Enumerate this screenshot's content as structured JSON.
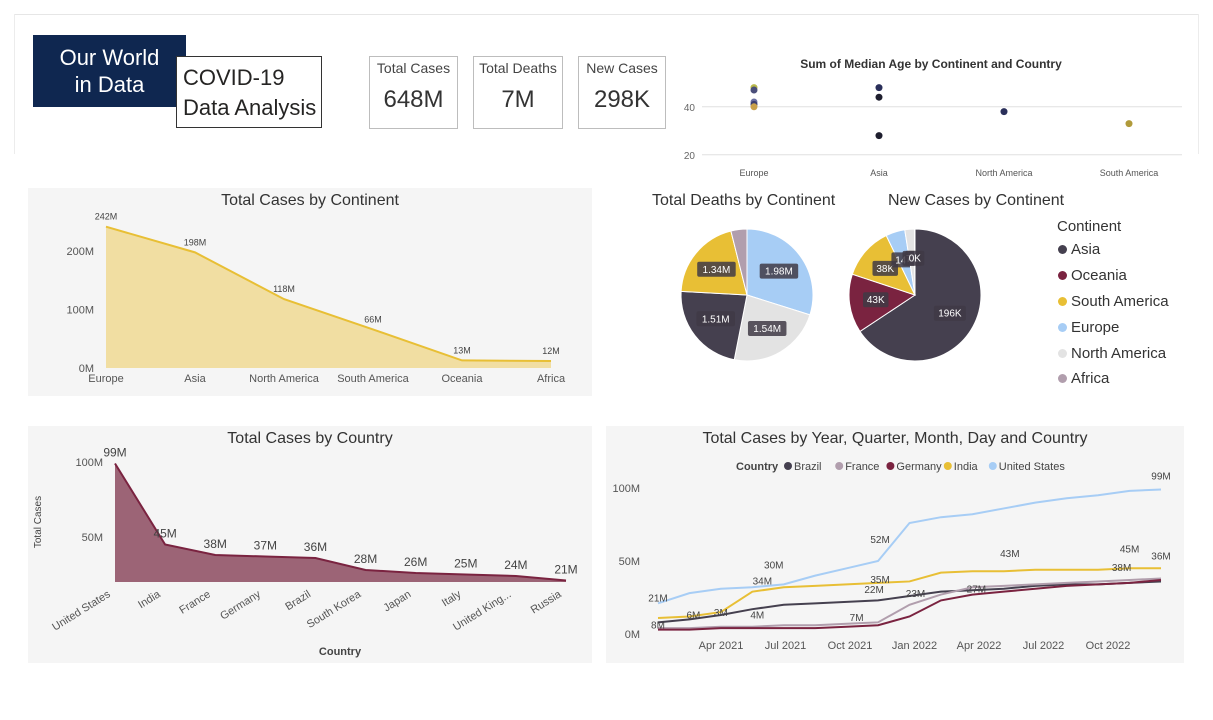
{
  "logo": {
    "line1": "Our World",
    "line2": "in Data"
  },
  "title": {
    "line1": "COVID-19",
    "line2": "Data Analysis"
  },
  "kpis": [
    {
      "label": "Total Cases",
      "value": "648M"
    },
    {
      "label": "Total Deaths",
      "value": "7M"
    },
    {
      "label": "New Cases",
      "value": "298K"
    }
  ],
  "colors": {
    "Asia": "#45404f",
    "Oceania": "#7a2340",
    "South America": "#e8bf35",
    "Europe": "#a7cdf5",
    "North America": "#e3e3e3",
    "Africa": "#b19ead",
    "area_yellow": "#eecf6a",
    "area_maroon": "#8c4a5f"
  },
  "chart_data": [
    {
      "type": "scatter",
      "title": "Sum of Median Age by Continent and Country",
      "categories": [
        "Europe",
        "Asia",
        "North America",
        "South America"
      ],
      "yticks": [
        20,
        40
      ],
      "ylim": [
        17,
        52
      ],
      "points": [
        {
          "category": "Europe",
          "y": 48,
          "color": "#b9b94a"
        },
        {
          "category": "Europe",
          "y": 47,
          "color": "#4a4e7a"
        },
        {
          "category": "Europe",
          "y": 42,
          "color": "#6a6fa0"
        },
        {
          "category": "Europe",
          "y": 41,
          "color": "#3c3e70"
        },
        {
          "category": "Europe",
          "y": 40,
          "color": "#c9a04a"
        },
        {
          "category": "Asia",
          "y": 48,
          "color": "#2a2f5a"
        },
        {
          "category": "Asia",
          "y": 44,
          "color": "#1e1e2e"
        },
        {
          "category": "Asia",
          "y": 28,
          "color": "#1e1e2e"
        },
        {
          "category": "North America",
          "y": 38,
          "color": "#2a2f5a"
        },
        {
          "category": "South America",
          "y": 33,
          "color": "#b09a3a"
        }
      ]
    },
    {
      "type": "area",
      "title": "Total Cases by Continent",
      "categories": [
        "Europe",
        "Asia",
        "North America",
        "South America",
        "Oceania",
        "Africa"
      ],
      "values": [
        242,
        198,
        118,
        66,
        13,
        12
      ],
      "data_labels": [
        "242M",
        "198M",
        "118M",
        "66M",
        "13M",
        "12M"
      ],
      "yticks": [
        "0M",
        "100M",
        "200M"
      ],
      "ylim": [
        0,
        250
      ]
    },
    {
      "type": "pie",
      "title": "Total Deaths by Continent",
      "slices": [
        {
          "name": "Europe",
          "value": 1.98,
          "label": "1.98M"
        },
        {
          "name": "North America",
          "value": 1.54,
          "label": "1.54M"
        },
        {
          "name": "Asia",
          "value": 1.51,
          "label": "1.51M"
        },
        {
          "name": "South America",
          "value": 1.34,
          "label": "1.34M"
        },
        {
          "name": "Africa",
          "value": 0.26,
          "label": ""
        }
      ]
    },
    {
      "type": "pie",
      "title": "New Cases by Continent",
      "slices": [
        {
          "name": "Asia",
          "value": 196,
          "label": "196K"
        },
        {
          "name": "Oceania",
          "value": 43,
          "label": "43K"
        },
        {
          "name": "South America",
          "value": 38,
          "label": "38K"
        },
        {
          "name": "Europe",
          "value": 14,
          "label": "14K"
        },
        {
          "name": "North America",
          "value": 7,
          "label": "7K"
        },
        {
          "name": "Africa",
          "value": 0.4,
          "label": "0K"
        }
      ]
    },
    {
      "type": "area",
      "title": "Total Cases by Country",
      "categories": [
        "United States",
        "India",
        "France",
        "Germany",
        "Brazil",
        "South Korea",
        "Japan",
        "Italy",
        "United King...",
        "Russia"
      ],
      "values": [
        99,
        45,
        38,
        37,
        36,
        28,
        26,
        25,
        24,
        21
      ],
      "data_labels": [
        "99M",
        "45M",
        "38M",
        "37M",
        "36M",
        "28M",
        "26M",
        "25M",
        "24M",
        "21M"
      ],
      "xlabel": "Country",
      "ylabel": "Total Cases",
      "yticks": [
        "50M",
        "100M"
      ],
      "ylim": [
        20,
        100
      ]
    },
    {
      "type": "line",
      "title": "Total Cases by Year, Quarter, Month, Day and Country",
      "legend_title": "Country",
      "xticks": [
        "Apr 2021",
        "Jul 2021",
        "Oct 2021",
        "Jan 2022",
        "Apr 2022",
        "Jul 2022",
        "Oct 2022"
      ],
      "yticks": [
        "0M",
        "50M",
        "100M"
      ],
      "ylim": [
        0,
        100
      ],
      "series": [
        {
          "name": "Brazil",
          "color": "#45404f",
          "points": [
            [
              0,
              8
            ],
            [
              1,
              10
            ],
            [
              2,
              13
            ],
            [
              3,
              17
            ],
            [
              4,
              20
            ],
            [
              5,
              21
            ],
            [
              6,
              22
            ],
            [
              7,
              23
            ],
            [
              8,
              26
            ],
            [
              9,
              29
            ],
            [
              10,
              30
            ],
            [
              11,
              31
            ],
            [
              12,
              33
            ],
            [
              13,
              34
            ],
            [
              14,
              34
            ],
            [
              15,
              35
            ],
            [
              16,
              36
            ]
          ],
          "labels": [
            [
              2,
              "3M"
            ],
            [
              8,
              "23M"
            ]
          ]
        },
        {
          "name": "France",
          "color": "#b19ead",
          "points": [
            [
              0,
              4
            ],
            [
              1,
              4
            ],
            [
              2,
              5
            ],
            [
              3,
              5
            ],
            [
              4,
              6
            ],
            [
              5,
              6
            ],
            [
              6,
              7
            ],
            [
              7,
              8
            ],
            [
              8,
              20
            ],
            [
              9,
              27
            ],
            [
              10,
              32
            ],
            [
              11,
              33
            ],
            [
              12,
              34
            ],
            [
              13,
              35
            ],
            [
              14,
              36
            ],
            [
              15,
              37
            ],
            [
              16,
              38
            ]
          ],
          "labels": [
            [
              3,
              "4M"
            ],
            [
              6,
              "7M"
            ],
            [
              15,
              "38M"
            ]
          ]
        },
        {
          "name": "Germany",
          "color": "#7a2340",
          "points": [
            [
              0,
              3
            ],
            [
              1,
              3
            ],
            [
              2,
              4
            ],
            [
              3,
              4
            ],
            [
              4,
              4
            ],
            [
              5,
              4
            ],
            [
              6,
              5
            ],
            [
              7,
              6
            ],
            [
              8,
              12
            ],
            [
              9,
              23
            ],
            [
              10,
              27
            ],
            [
              11,
              29
            ],
            [
              12,
              31
            ],
            [
              13,
              33
            ],
            [
              14,
              34
            ],
            [
              15,
              35
            ],
            [
              16,
              37
            ]
          ],
          "labels": [
            [
              0,
              "8M"
            ],
            [
              10,
              "27M"
            ]
          ]
        },
        {
          "name": "India",
          "color": "#e8bf35",
          "points": [
            [
              0,
              11
            ],
            [
              1,
              12
            ],
            [
              2,
              15
            ],
            [
              3,
              29
            ],
            [
              4,
              32
            ],
            [
              5,
              33
            ],
            [
              6,
              34
            ],
            [
              7,
              35
            ],
            [
              8,
              36
            ],
            [
              9,
              42
            ],
            [
              10,
              43
            ],
            [
              11,
              43
            ],
            [
              12,
              44
            ],
            [
              13,
              44
            ],
            [
              14,
              44
            ],
            [
              15,
              45
            ],
            [
              16,
              45
            ]
          ],
          "labels": [
            [
              1,
              "6M"
            ],
            [
              3,
              "34M"
            ],
            [
              7,
              "22M"
            ],
            [
              11,
              "43M"
            ],
            [
              15,
              "45M"
            ]
          ]
        },
        {
          "name": "United States",
          "color": "#a7cdf5",
          "points": [
            [
              0,
              21
            ],
            [
              1,
              28
            ],
            [
              2,
              31
            ],
            [
              3,
              32
            ],
            [
              4,
              34
            ],
            [
              5,
              40
            ],
            [
              6,
              45
            ],
            [
              7,
              50
            ],
            [
              8,
              76
            ],
            [
              9,
              80
            ],
            [
              10,
              82
            ],
            [
              11,
              86
            ],
            [
              12,
              90
            ],
            [
              13,
              93
            ],
            [
              14,
              95
            ],
            [
              15,
              98
            ],
            [
              16,
              99
            ]
          ],
          "labels": [
            [
              0,
              "21M"
            ],
            [
              4,
              "30M"
            ],
            [
              7,
              "52M"
            ],
            [
              7,
              "35M"
            ],
            [
              16,
              "99M"
            ],
            [
              16,
              "36M"
            ]
          ]
        }
      ]
    }
  ],
  "legend": {
    "title": "Continent",
    "items": [
      "Asia",
      "Oceania",
      "South America",
      "Europe",
      "North America",
      "Africa"
    ]
  }
}
